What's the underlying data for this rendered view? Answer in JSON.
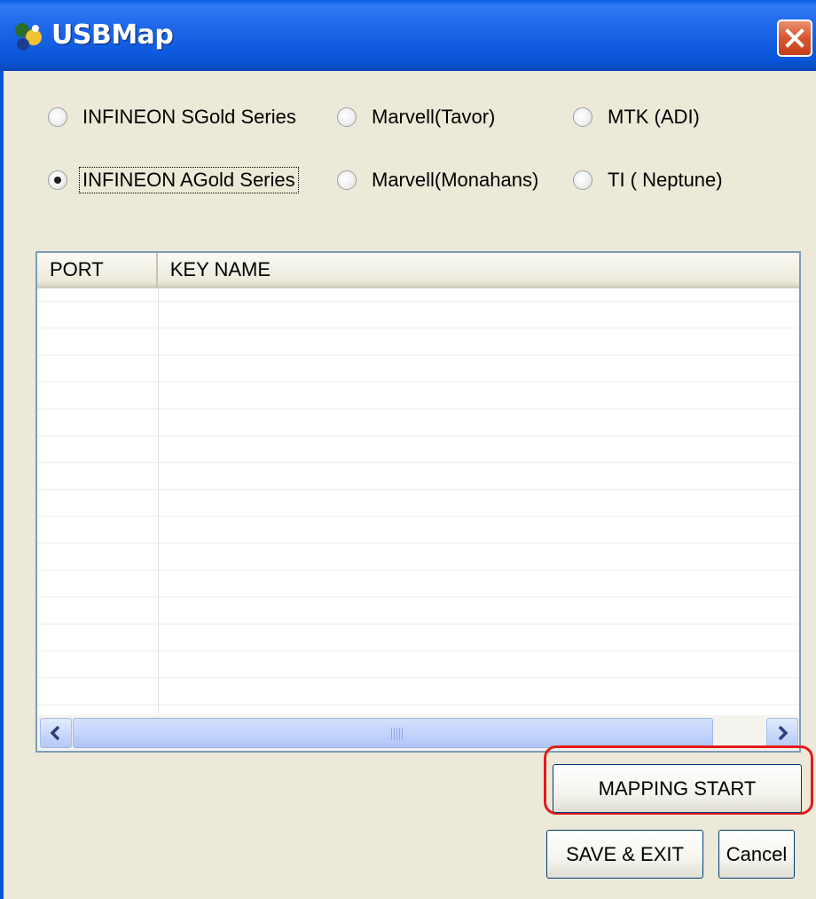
{
  "window": {
    "title": "USBMap",
    "icon": "usbmap-app-icon",
    "close_icon": "close-icon"
  },
  "radios": {
    "sgold": {
      "label": "INFINEON SGold Series",
      "checked": false
    },
    "tavor": {
      "label": "Marvell(Tavor)",
      "checked": false
    },
    "mtk": {
      "label": "MTK (ADI)",
      "checked": false
    },
    "agold": {
      "label": "INFINEON AGold Series",
      "checked": true
    },
    "monahans": {
      "label": "Marvell(Monahans)",
      "checked": false
    },
    "neptune": {
      "label": "TI ( Neptune)",
      "checked": false
    }
  },
  "table": {
    "columns": [
      "PORT",
      "KEY NAME"
    ],
    "rows": []
  },
  "scrollbar": {
    "left_icon": "chevron-left-icon",
    "right_icon": "chevron-right-icon"
  },
  "buttons": {
    "mapping_start": "MAPPING START",
    "save_exit": "SAVE & EXIT",
    "cancel": "Cancel"
  },
  "colors": {
    "titlebar": "#0a55d8",
    "highlight": "#e31b1b",
    "dialog": "#ece9d8"
  }
}
